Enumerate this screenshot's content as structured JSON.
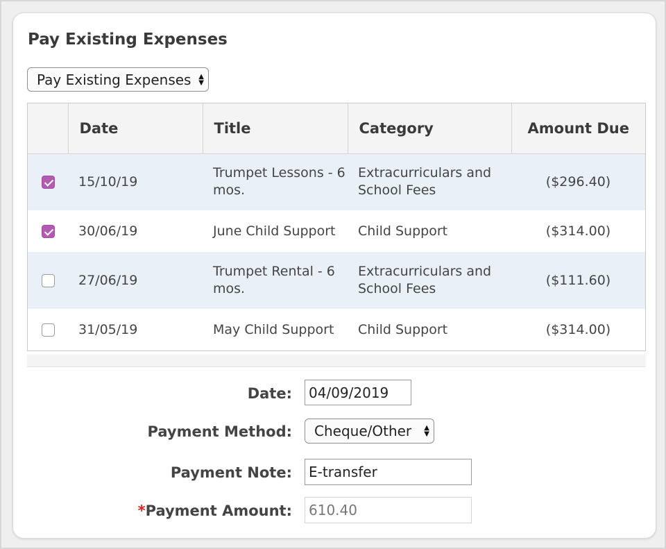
{
  "heading": "Pay Existing Expenses",
  "mode_select": {
    "value": "Pay Existing Expenses"
  },
  "table": {
    "headers": [
      "",
      "Date",
      "Title",
      "Category",
      "Amount Due"
    ],
    "rows": [
      {
        "checked": true,
        "date": "15/10/19",
        "title": "Trumpet Lessons - 6 mos.",
        "category": "Extracurriculars and School Fees",
        "amount": "($296.40)"
      },
      {
        "checked": true,
        "date": "30/06/19",
        "title": "June Child Support",
        "category": "Child Support",
        "amount": "($314.00)"
      },
      {
        "checked": false,
        "date": "27/06/19",
        "title": "Trumpet Rental - 6 mos.",
        "category": "Extracurriculars and School Fees",
        "amount": "($111.60)"
      },
      {
        "checked": false,
        "date": "31/05/19",
        "title": "May Child Support",
        "category": "Child Support",
        "amount": "($314.00)"
      }
    ]
  },
  "form": {
    "date_label": "Date:",
    "date_value": "04/09/2019",
    "method_label": "Payment Method:",
    "method_value": "Cheque/Other",
    "note_label": "Payment Note:",
    "note_value": "E-transfer",
    "amount_required_mark": "*",
    "amount_label": "Payment Amount:",
    "amount_value": "610.40"
  },
  "colors": {
    "accent": "#b35bb3",
    "row_stripe": "#eaf0f7",
    "required": "#dd2222"
  }
}
